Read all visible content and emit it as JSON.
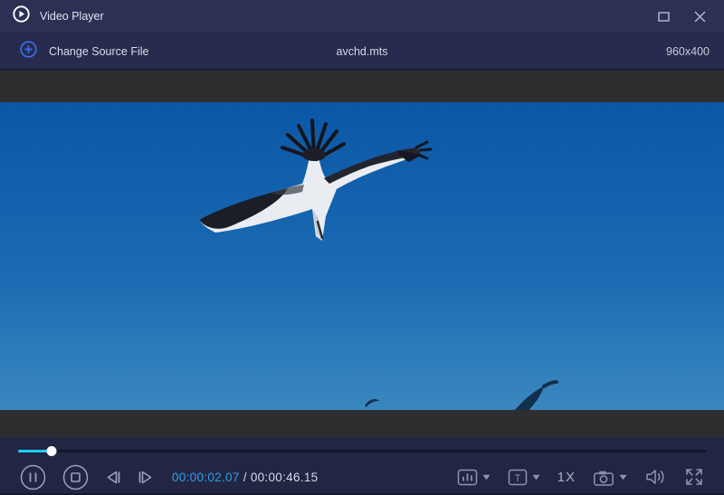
{
  "titlebar": {
    "title": "Video Player"
  },
  "toolbar": {
    "change_source_label": "Change Source File",
    "filename": "avchd.mts",
    "resolution": "960x400"
  },
  "player": {
    "progress_percent": 4.9,
    "current_time": "00:00:02.07",
    "time_separator": "/",
    "total_time": "00:00:46.15",
    "speed_label": "1X",
    "subtitle_icon_letter": "T"
  },
  "video": {
    "scene": "white seabird with black wingtips flying in a blue sky"
  },
  "colors": {
    "titlebar_bg": "#2c3054",
    "toolbar_bg": "#272b4d",
    "controlbar_bg": "#232642",
    "letterbox": "#2e2e31",
    "accent_blue": "#3d6ef0",
    "progress_cyan": "#1fcdf0",
    "time_blue": "#2f9bf2",
    "sky_top": "#0b57a6",
    "sky_bottom": "#3a87bf",
    "icon_gray": "#8e93b4"
  }
}
